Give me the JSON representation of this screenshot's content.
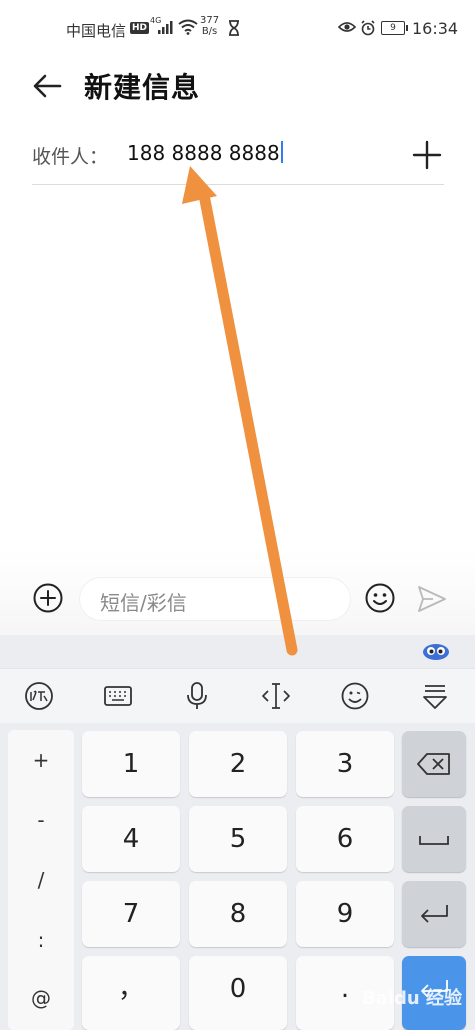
{
  "status_bar": {
    "carrier": "中国电信",
    "hd_badge": "HD",
    "network": "4G",
    "speed_value": "377",
    "speed_unit": "B/s",
    "battery_level": "9",
    "time": "16:34"
  },
  "header": {
    "title": "新建信息"
  },
  "recipient": {
    "label": "收件人：",
    "value": "188 8888 8888"
  },
  "composer": {
    "placeholder": "短信/彩信"
  },
  "keyboard": {
    "side_keys": [
      "+",
      "-",
      "/",
      ":",
      "@"
    ],
    "numpad": {
      "k1": "1",
      "k2": "2",
      "k3": "3",
      "k4": "4",
      "k5": "5",
      "k6": "6",
      "k7": "7",
      "k8": "8",
      "k9": "9",
      "comma": "，",
      "k0": "0",
      "dot": "."
    },
    "toolbar_icons": [
      "handwriting-icon",
      "keyboard-icon",
      "microphone-icon",
      "cursor-icon",
      "emoji-icon",
      "collapse-keyboard-icon"
    ]
  },
  "watermark": "Baidu 经验",
  "colors": {
    "accent": "#2f7df6",
    "annotation_arrow": "#f0913f",
    "enter_key": "#4a94ea"
  }
}
